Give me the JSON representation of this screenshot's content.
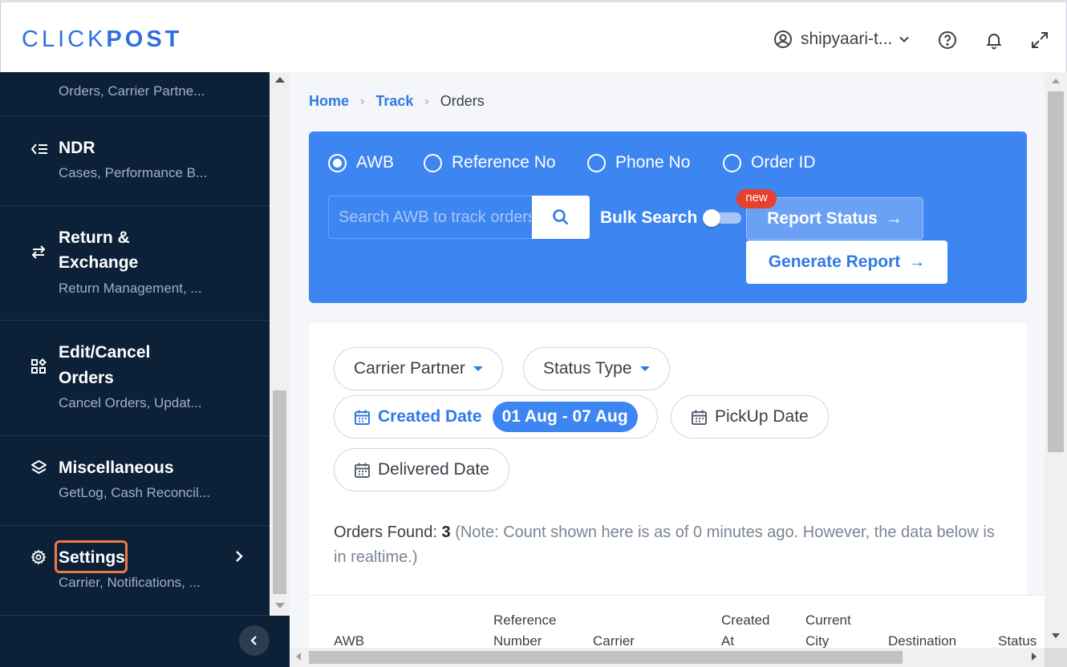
{
  "brand": {
    "logo_light": "CLICK",
    "logo_bold": "POST",
    "accent": "#2f7ae5",
    "panel_color": "#3d85f0",
    "sidebar_bg": "#0c2138"
  },
  "header": {
    "user_name": "shipyaari-t...",
    "icons": [
      "user-circle-icon",
      "chevron-down-icon",
      "help-icon",
      "bell-icon",
      "expand-icon"
    ]
  },
  "sidebar": {
    "items": [
      {
        "title": "",
        "subtitle": "Orders, Carrier Partne...",
        "icon": ""
      },
      {
        "title": "NDR",
        "subtitle": "Cases, Performance B...",
        "icon": "ndr-icon"
      },
      {
        "title_line1": "Return &",
        "title_line2": "Exchange",
        "subtitle": "Return Management, ...",
        "icon": "swap-arrows-icon"
      },
      {
        "title_line1": "Edit/Cancel",
        "title_line2": "Orders",
        "subtitle": "Cancel Orders, Updat...",
        "icon": "grid-edit-icon"
      },
      {
        "title": "Miscellaneous",
        "subtitle": "GetLog, Cash Reconcil...",
        "icon": "layers-icon"
      },
      {
        "title": "Settings",
        "subtitle": "Carrier, Notifications, ...",
        "icon": "gear-icon",
        "highlighted": true
      }
    ]
  },
  "breadcrumb": {
    "home": "Home",
    "track": "Track",
    "current": "Orders"
  },
  "search": {
    "options": [
      "AWB",
      "Reference No",
      "Phone No",
      "Order ID"
    ],
    "selected": "AWB",
    "placeholder": "Search AWB to track orders",
    "bulk_label": "Bulk Search",
    "new_badge": "new",
    "report_status": "Report Status",
    "generate_report": "Generate Report"
  },
  "filters": {
    "carrier_partner": "Carrier Partner",
    "status_type": "Status Type",
    "created_date": "Created Date",
    "created_range": "01 Aug - 07 Aug",
    "pickup_date": "PickUp Date",
    "delivered_date": "Delivered Date"
  },
  "results": {
    "label": "Orders Found:",
    "count": "3",
    "note": "(Note: Count shown here is as of 0 minutes ago. However, the data below is in realtime.)"
  },
  "table": {
    "columns": [
      "AWB",
      "Reference Number",
      "Carrier",
      "Created At",
      "Current City",
      "Destination",
      "Status"
    ]
  }
}
